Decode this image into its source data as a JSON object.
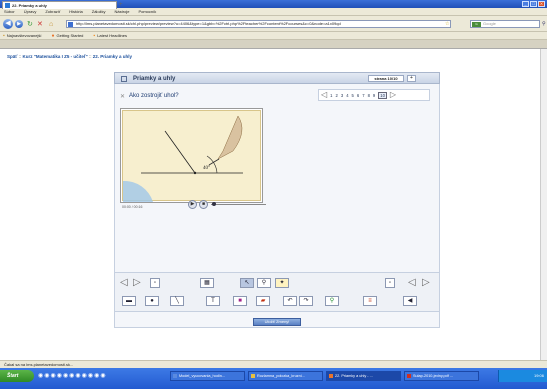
{
  "window": {
    "title": "22. Priamky a uhly - Mozilla Firefox",
    "buttons": [
      "_",
      "□",
      "X"
    ]
  },
  "menu": [
    "Súbor",
    "Úpravy",
    "Zobraziť",
    "História",
    "Záložky",
    "Nástroje",
    "Pomocník"
  ],
  "nav": {
    "url": "http://lms.planetavedomosti.sk/chl.php/preview/preview?u=4406&type=1&gbb=%2Fctrl.php%2Fteacher%2Fcontent%2Fcourses&c=0&node=a1x09qd",
    "search_placeholder": "Google",
    "search_engine": "G"
  },
  "bookmarks": [
    "Najnavštevovanejší",
    "Getting Started",
    "Latest Headlines"
  ],
  "tab": {
    "label": "22. Priamky a uhly",
    "new_tab": "+"
  },
  "breadcrumb": {
    "back": "Späť",
    "sep": "::",
    "course": "Kurz \"Matematika I Z5 - učiteľ\"",
    "page": "22. Priamky a uhly"
  },
  "panel": {
    "title": "Priamky a uhly",
    "page_indicator": "strana 10/10",
    "plus": "+"
  },
  "question": {
    "title": "Ako zostrojiť uhol?",
    "close": "✕"
  },
  "pager": {
    "pages": [
      "1",
      "2",
      "3",
      "4",
      "5",
      "6",
      "7",
      "8",
      "9",
      "10"
    ],
    "current": "10"
  },
  "video": {
    "angle_label": "40°",
    "time": "00:00 / 00:16"
  },
  "submit_label": "Uložiť Zmeny!",
  "statusbar": "Čakal sa na lms.planetavedomosti.sk...",
  "taskbar": {
    "start": "Štart",
    "items": [
      {
        "label": "Model_vyucovania_hodin...",
        "active": false
      },
      {
        "label": "Rozlamna_polozka_kruzni...",
        "active": false
      },
      {
        "label": "22. Priamky a uhly - ...",
        "active": true
      },
      {
        "label": "Sulap-2010-jedny.pdf ...",
        "active": false
      }
    ],
    "clock": "19:06"
  }
}
